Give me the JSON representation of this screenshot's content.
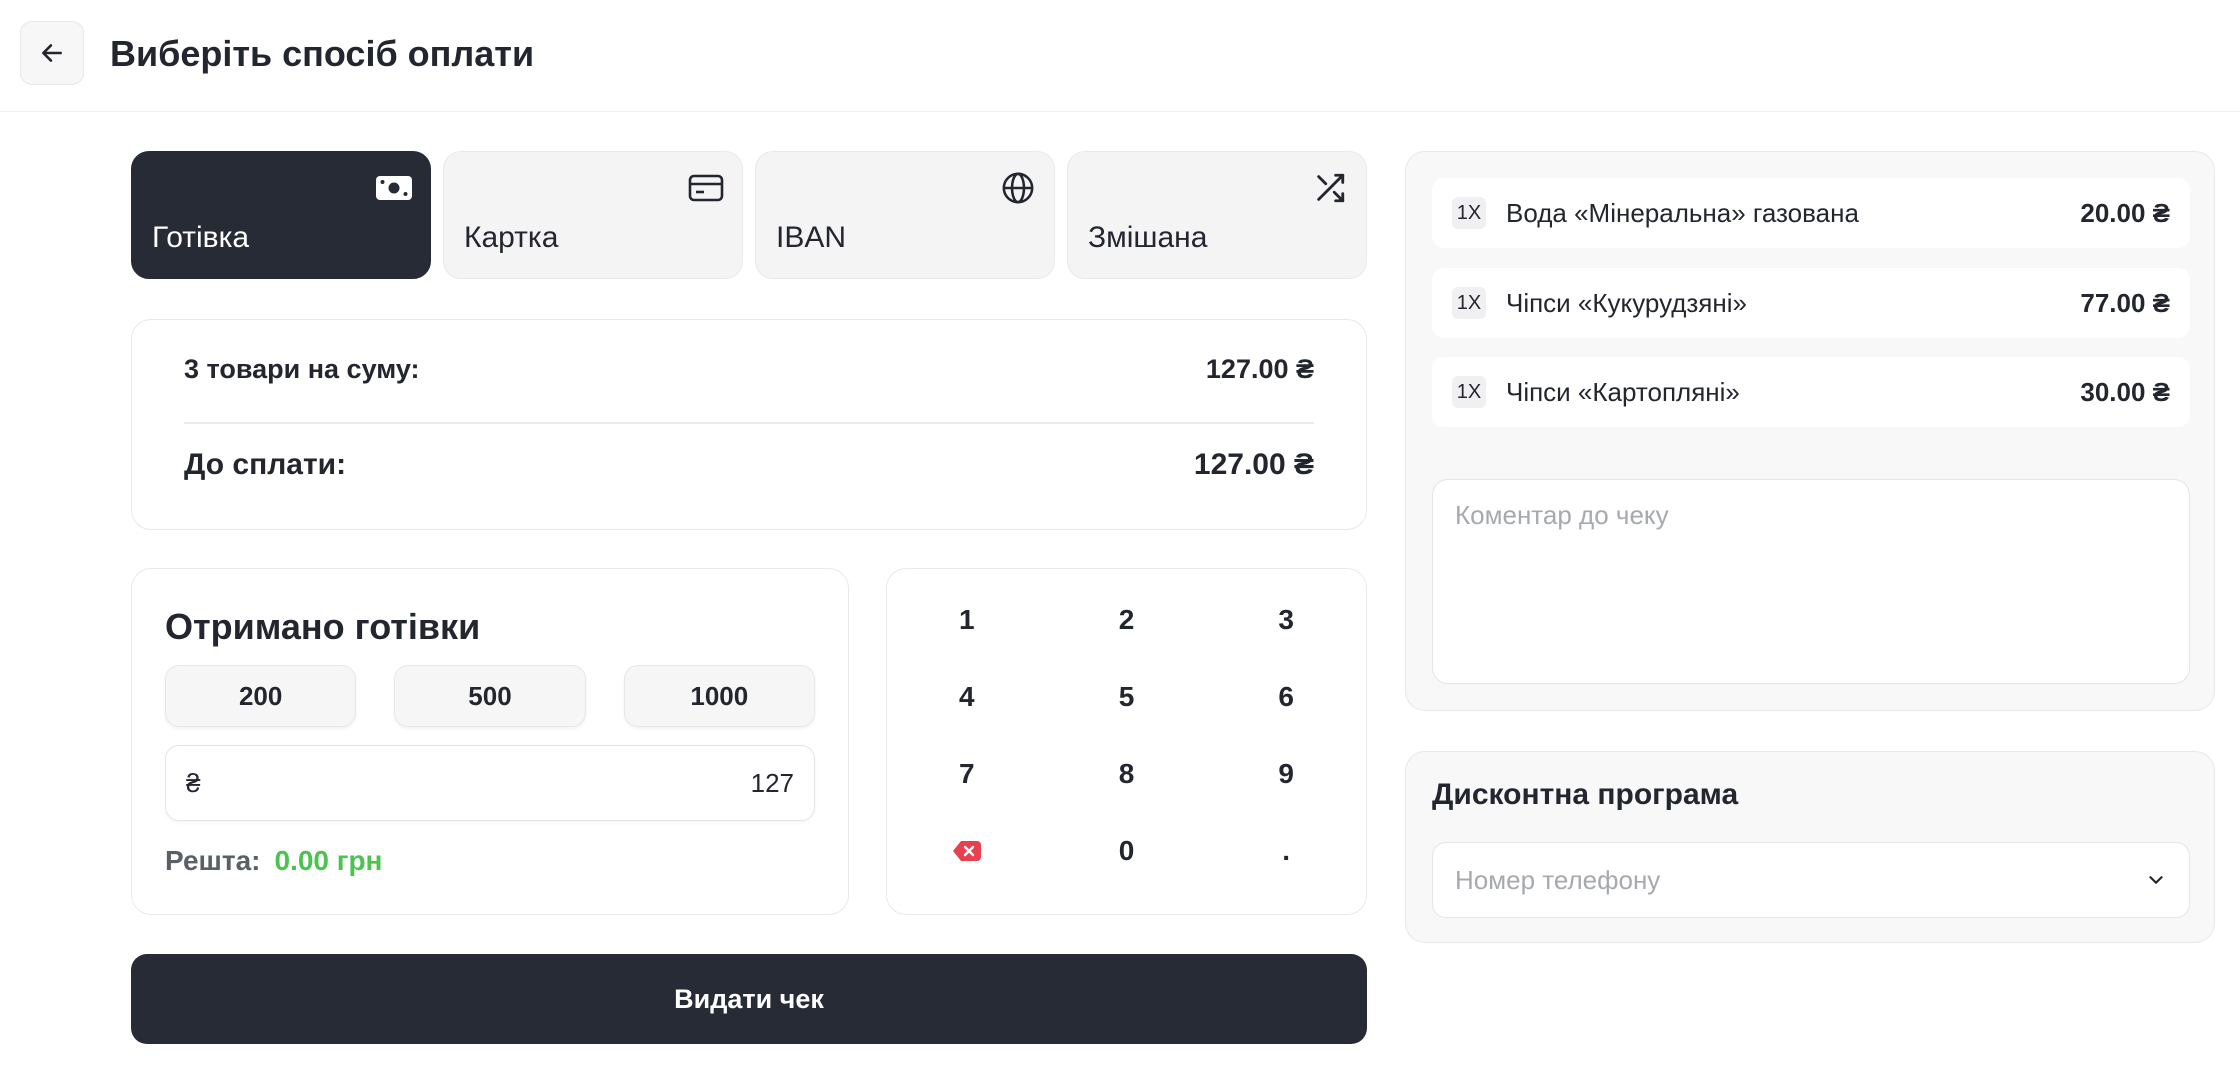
{
  "header": {
    "title": "Виберіть спосіб оплати",
    "back_icon": "arrow-left-icon"
  },
  "payment_tabs": [
    {
      "label": "Готівка",
      "icon": "cash-icon",
      "active": true
    },
    {
      "label": "Картка",
      "icon": "credit-card-icon",
      "active": false
    },
    {
      "label": "IBAN",
      "icon": "globe-icon",
      "active": false
    },
    {
      "label": "Змішана",
      "icon": "shuffle-icon",
      "active": false
    }
  ],
  "summary": {
    "items_label": "3 товари на суму:",
    "items_total": "127.00 ₴",
    "due_label": "До сплати:",
    "due_total": "127.00 ₴"
  },
  "cash": {
    "title": "Отримано готівки",
    "quick_amounts": [
      "200",
      "500",
      "1000"
    ],
    "currency_symbol": "₴",
    "input_value": "127",
    "change_label": "Решта:",
    "change_value": "0.00 грн"
  },
  "keypad": {
    "keys": [
      "1",
      "2",
      "3",
      "4",
      "5",
      "6",
      "7",
      "8",
      "9",
      "backspace",
      "0",
      "."
    ]
  },
  "issue_button": "Видати чек",
  "order": {
    "items": [
      {
        "qty": "1X",
        "name": "Вода «Мінеральна» газована",
        "price": "20.00 ₴"
      },
      {
        "qty": "1X",
        "name": "Чіпси «Кукурудзяні»",
        "price": "77.00 ₴"
      },
      {
        "qty": "1X",
        "name": "Чіпси «Картопляні»",
        "price": "30.00 ₴"
      }
    ],
    "comment_placeholder": "Коментар до чеку"
  },
  "discount": {
    "title": "Дисконтна програма",
    "phone_placeholder": "Номер телефону"
  },
  "colors": {
    "primary_dark": "#272b36",
    "change_green": "#4cc34f",
    "backspace_red": "#e8404f"
  }
}
